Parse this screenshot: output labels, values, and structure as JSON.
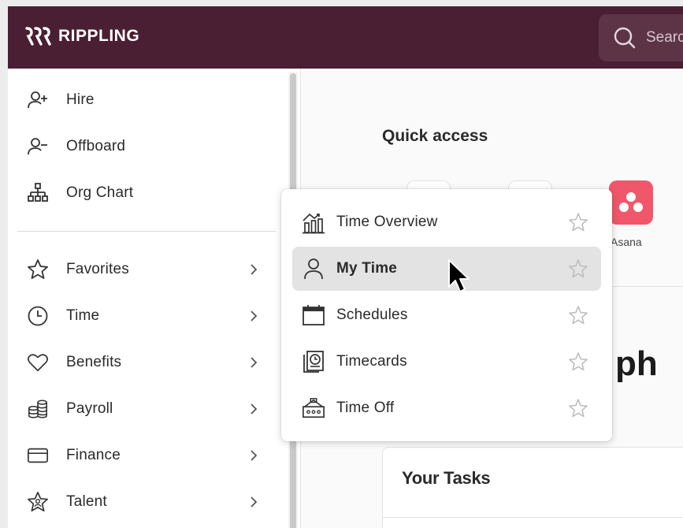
{
  "brand": {
    "name": "RIPPLING",
    "header_color": "#4a1f33"
  },
  "search": {
    "placeholder": "Search"
  },
  "sidebar": {
    "top_items": [
      {
        "label": "Hire",
        "icon": "person-add-icon"
      },
      {
        "label": "Offboard",
        "icon": "person-remove-icon"
      },
      {
        "label": "Org Chart",
        "icon": "org-chart-icon"
      }
    ],
    "items": [
      {
        "label": "Favorites",
        "icon": "star-icon"
      },
      {
        "label": "Time",
        "icon": "clock-icon"
      },
      {
        "label": "Benefits",
        "icon": "heart-icon"
      },
      {
        "label": "Payroll",
        "icon": "coins-icon"
      },
      {
        "label": "Finance",
        "icon": "credit-card-icon"
      },
      {
        "label": "Talent",
        "icon": "talent-star-icon"
      }
    ]
  },
  "main": {
    "quick_access_title": "Quick access",
    "apps": [
      {
        "label": "Asana",
        "color": "#f0576a"
      }
    ],
    "partial_heading": "ph",
    "tasks_title": "Your Tasks"
  },
  "time_menu": {
    "items": [
      {
        "label": "Time Overview",
        "icon": "time-overview-icon",
        "active": false
      },
      {
        "label": "My Time",
        "icon": "person-icon",
        "active": true
      },
      {
        "label": "Schedules",
        "icon": "calendar-icon",
        "active": false
      },
      {
        "label": "Timecards",
        "icon": "timecard-icon",
        "active": false
      },
      {
        "label": "Time Off",
        "icon": "time-off-icon",
        "active": false
      }
    ]
  }
}
